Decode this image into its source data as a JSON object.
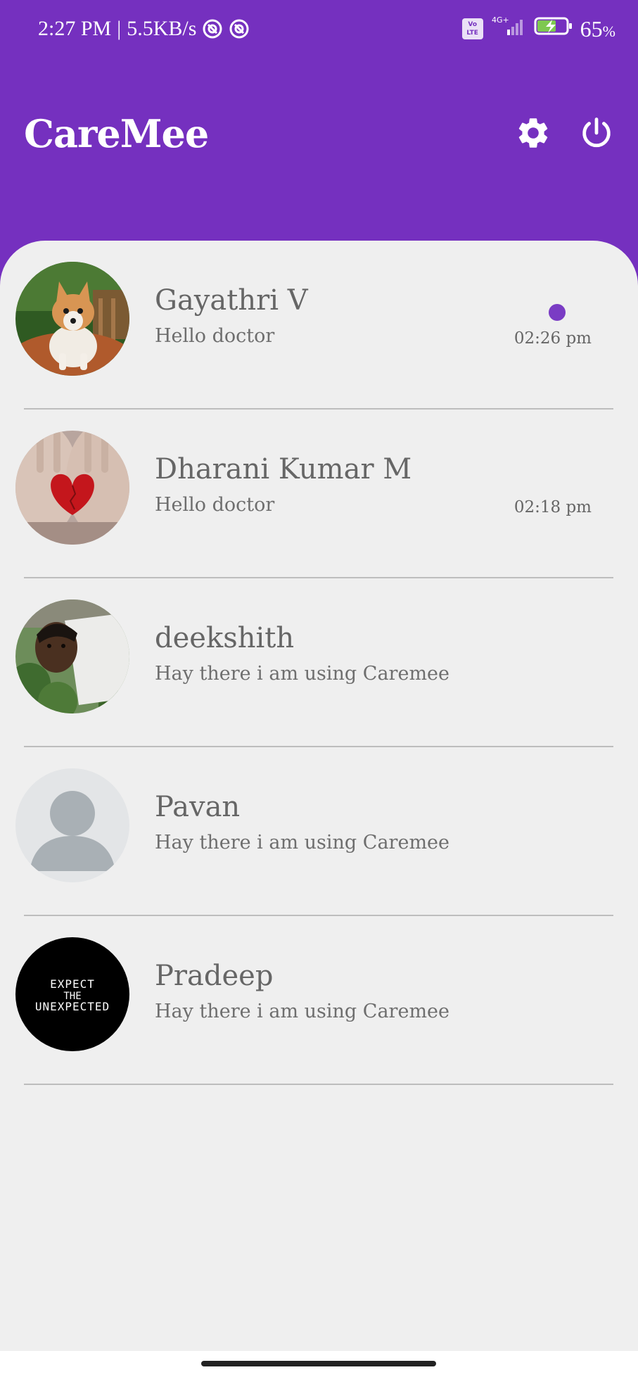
{
  "status_bar": {
    "time": "2:27 PM",
    "separator": "|",
    "network_speed": "5.5KB/s",
    "volte_label": "Vo LTE",
    "network_type": "4G+",
    "battery_percent": "65",
    "battery_unit": "%"
  },
  "header": {
    "title": "CareMee",
    "settings_icon": "gear-icon",
    "power_icon": "power-icon",
    "background_color": "#7530bf"
  },
  "chats": [
    {
      "name": "Gayathri V",
      "message": "Hello doctor",
      "time": "02:26 pm",
      "unread": true,
      "avatar": "dog-photo"
    },
    {
      "name": "Dharani Kumar M",
      "message": "Hello doctor",
      "time": "02:18 pm",
      "unread": false,
      "avatar": "heart-in-hands-photo"
    },
    {
      "name": "deekshith",
      "message": "Hay there i am using Caremee",
      "time": "",
      "unread": false,
      "avatar": "person-photo"
    },
    {
      "name": "Pavan",
      "message": "Hay there i am using Caremee",
      "time": "",
      "unread": false,
      "avatar": "default-person-placeholder"
    },
    {
      "name": "Pradeep",
      "message": "Hay there i am using Caremee",
      "time": "",
      "unread": false,
      "avatar": "expect-the-unexpected-image",
      "avatar_text": "EXPECT THE UNEXPECTED"
    }
  ],
  "colors": {
    "accent": "#7530bf",
    "unread_dot": "#7a3cc4",
    "list_background": "#efefef",
    "text_gray": "#666666"
  }
}
